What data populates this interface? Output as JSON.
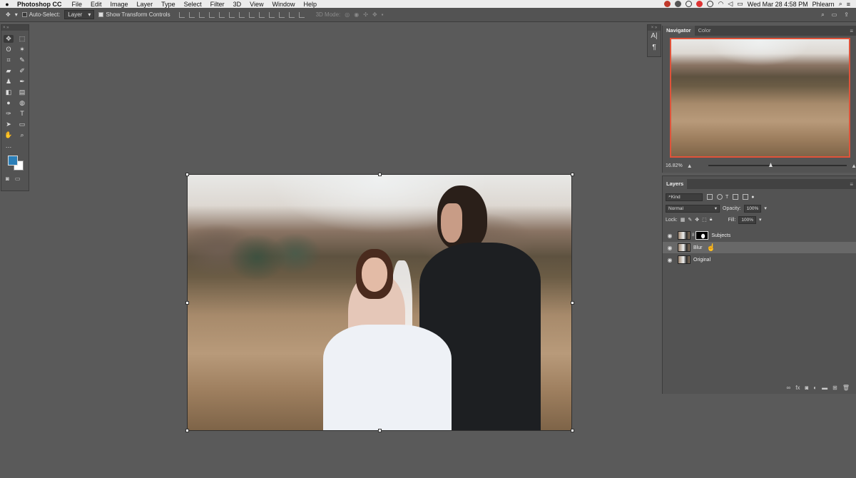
{
  "menubar": {
    "app_name": "Photoshop CC",
    "menus": [
      "File",
      "Edit",
      "Image",
      "Layer",
      "Type",
      "Select",
      "Filter",
      "3D",
      "View",
      "Window",
      "Help"
    ],
    "clock": "Wed Mar 28  4:58 PM",
    "user": "Phlearn"
  },
  "options": {
    "auto_select_label": "Auto-Select:",
    "auto_select_value": "Layer",
    "transform_label": "Show Transform Controls",
    "threed_label": "3D Mode:"
  },
  "navigator": {
    "tabs": [
      "Navigator",
      "Color"
    ],
    "zoom": "16.82%",
    "zoom_fraction": 0.45
  },
  "layers": {
    "tab": "Layers",
    "kind_label": "Kind",
    "blend_mode": "Normal",
    "opacity_label": "Opacity:",
    "opacity_value": "100%",
    "lock_label": "Lock:",
    "fill_label": "Fill:",
    "fill_value": "100%",
    "items": [
      {
        "name": "Subjects",
        "has_mask": true,
        "selected": false
      },
      {
        "name": "Blur",
        "has_mask": false,
        "selected": true
      },
      {
        "name": "Original",
        "has_mask": false,
        "selected": false
      }
    ]
  },
  "colors": {
    "foreground": "#2b7fb8",
    "background": "#ffffff",
    "navigator_frame": "#e0533a"
  }
}
